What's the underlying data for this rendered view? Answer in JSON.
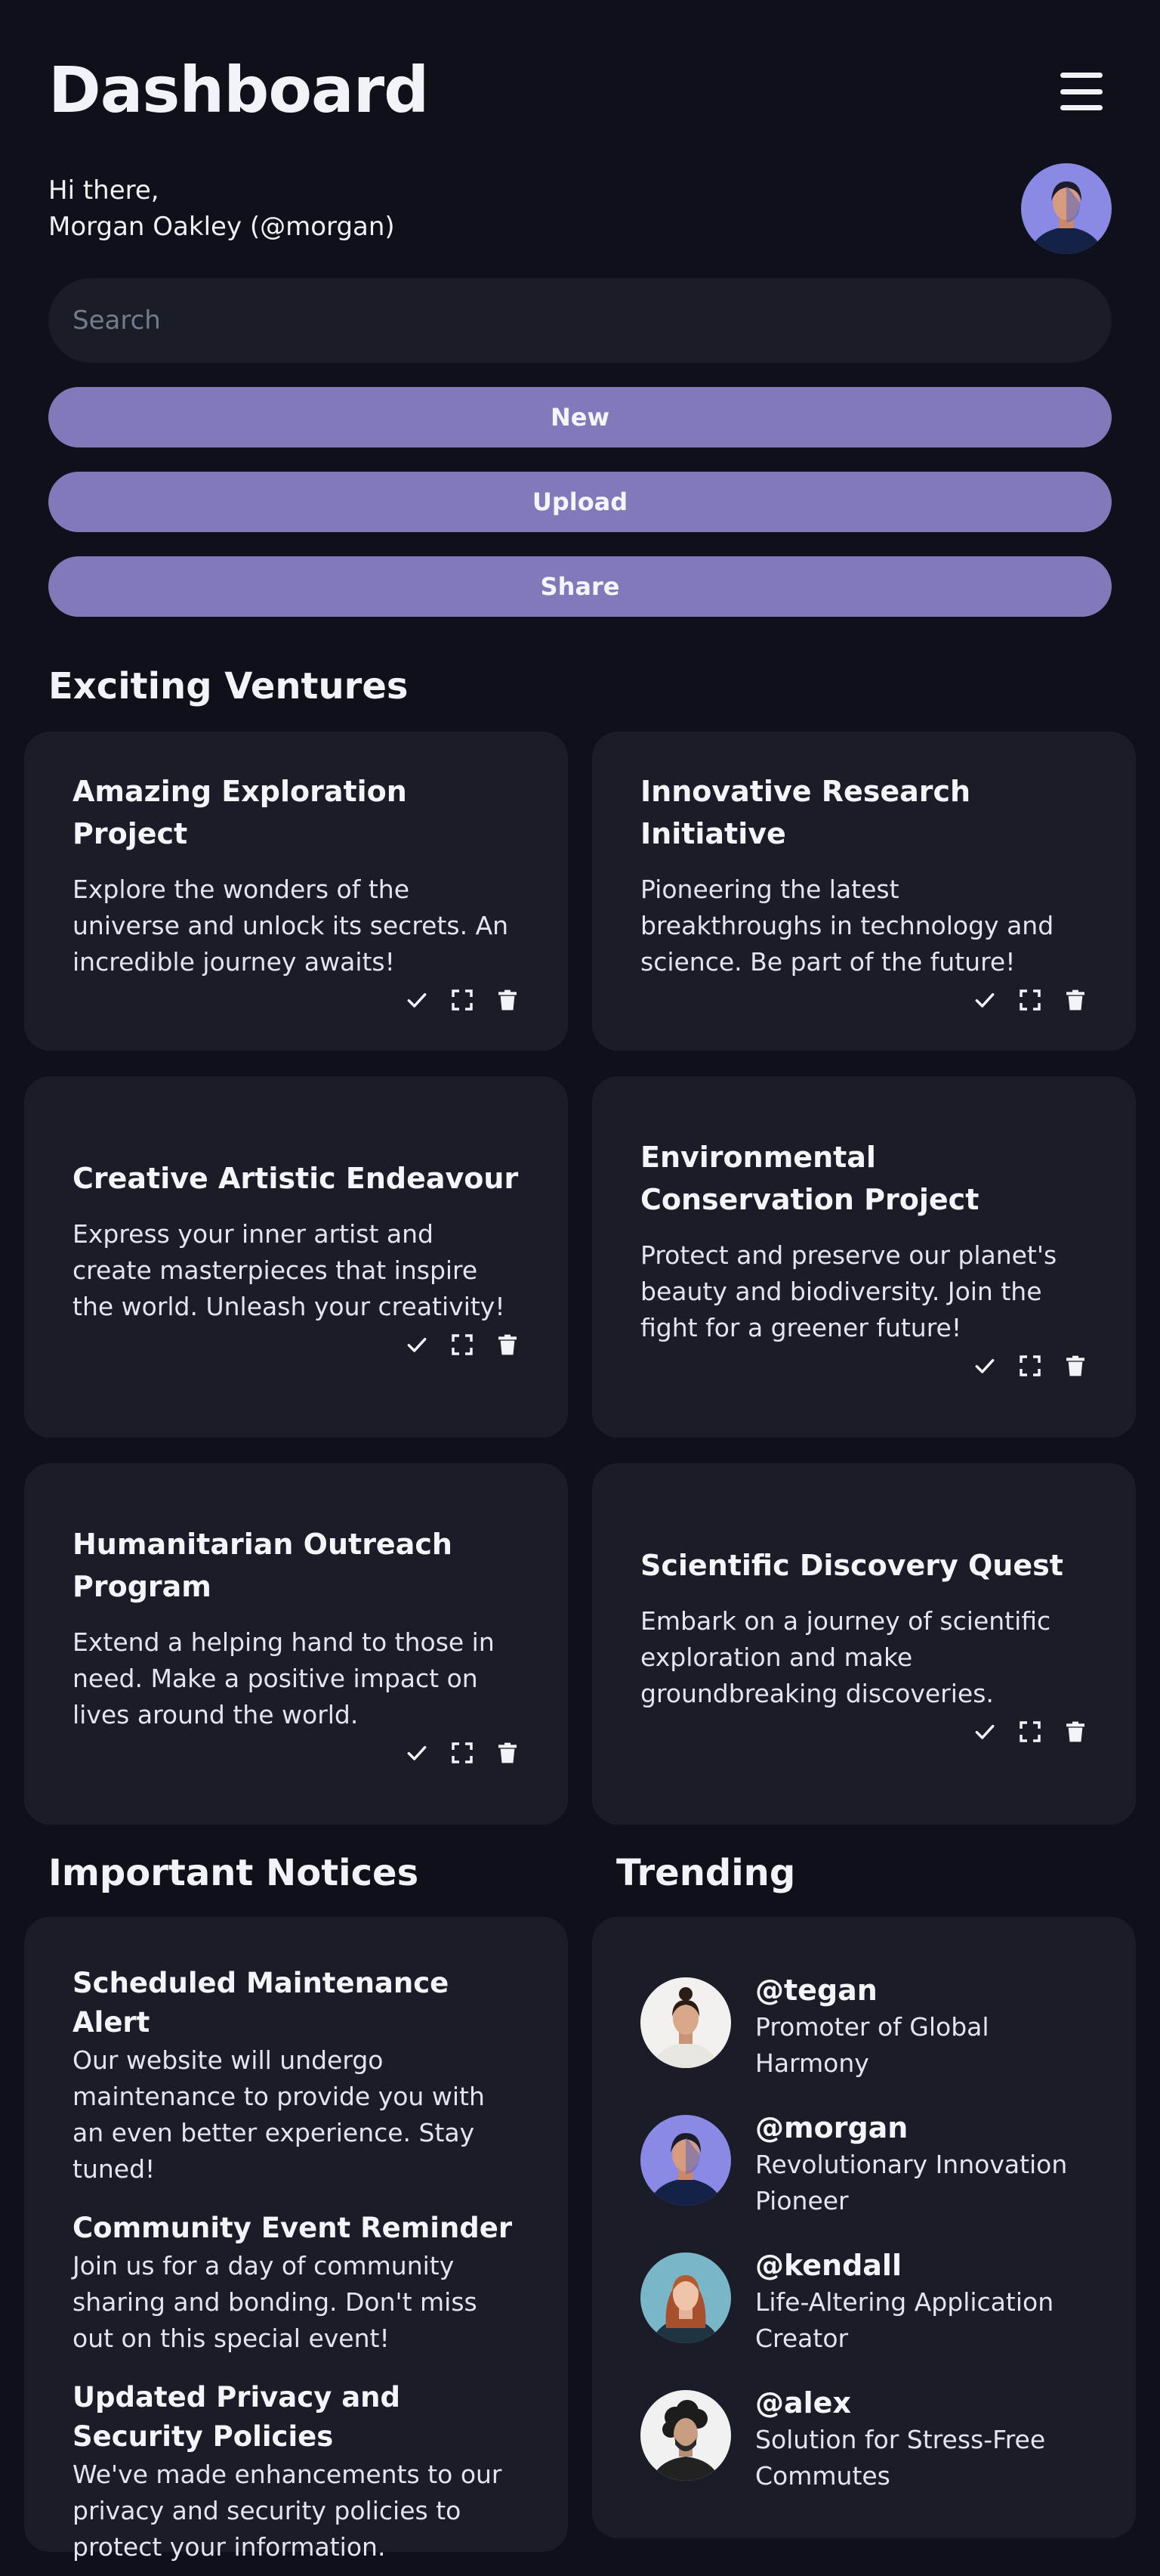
{
  "header": {
    "title": "Dashboard",
    "greeting_line1": "Hi there,",
    "greeting_line2": "Morgan Oakley (@morgan)"
  },
  "search": {
    "placeholder": "Search"
  },
  "actions": {
    "new_label": "New",
    "upload_label": "Upload",
    "share_label": "Share"
  },
  "ventures": {
    "heading": "Exciting Ventures",
    "items": [
      {
        "title": "Amazing Exploration Project",
        "description": "Explore the wonders of the universe and unlock its secrets. An incredible journey awaits!"
      },
      {
        "title": "Innovative Research Initiative",
        "description": "Pioneering the latest breakthroughs in technology and science. Be part of the future!"
      },
      {
        "title": "Creative Artistic Endeavour",
        "description": "Express your inner artist and create masterpieces that inspire the world. Unleash your creativity!"
      },
      {
        "title": "Environmental Conservation Project",
        "description": "Protect and preserve our planet's beauty and biodiversity. Join the fight for a greener future!"
      },
      {
        "title": "Humanitarian Outreach Program",
        "description": "Extend a helping hand to those in need. Make a positive impact on lives around the world."
      },
      {
        "title": "Scientific Discovery Quest",
        "description": "Embark on a journey of scientific exploration and make groundbreaking discoveries."
      }
    ]
  },
  "notices": {
    "heading": "Important Notices",
    "items": [
      {
        "title": "Scheduled Maintenance Alert",
        "body": "Our website will undergo maintenance to provide you with an even better experience. Stay tuned!"
      },
      {
        "title": "Community Event Reminder",
        "body": "Join us for a day of community sharing and bonding. Don't miss out on this special event!"
      },
      {
        "title": "Updated Privacy and Security Policies",
        "body": "We've made enhancements to our privacy and security policies to protect your information."
      }
    ]
  },
  "trending": {
    "heading": "Trending",
    "items": [
      {
        "handle": "@tegan",
        "role": "Promoter of Global Harmony"
      },
      {
        "handle": "@morgan",
        "role": "Revolutionary Innovation Pioneer"
      },
      {
        "handle": "@kendall",
        "role": "Life-Altering Application Creator"
      },
      {
        "handle": "@alex",
        "role": "Solution for Stress-Free Commutes"
      }
    ]
  },
  "colors": {
    "background": "#0f111a",
    "card": "#1a1c28",
    "accent": "#8279ba",
    "text": "#f2f3f8"
  },
  "icons": [
    "menu-icon",
    "check-icon",
    "expand-icon",
    "trash-icon"
  ]
}
